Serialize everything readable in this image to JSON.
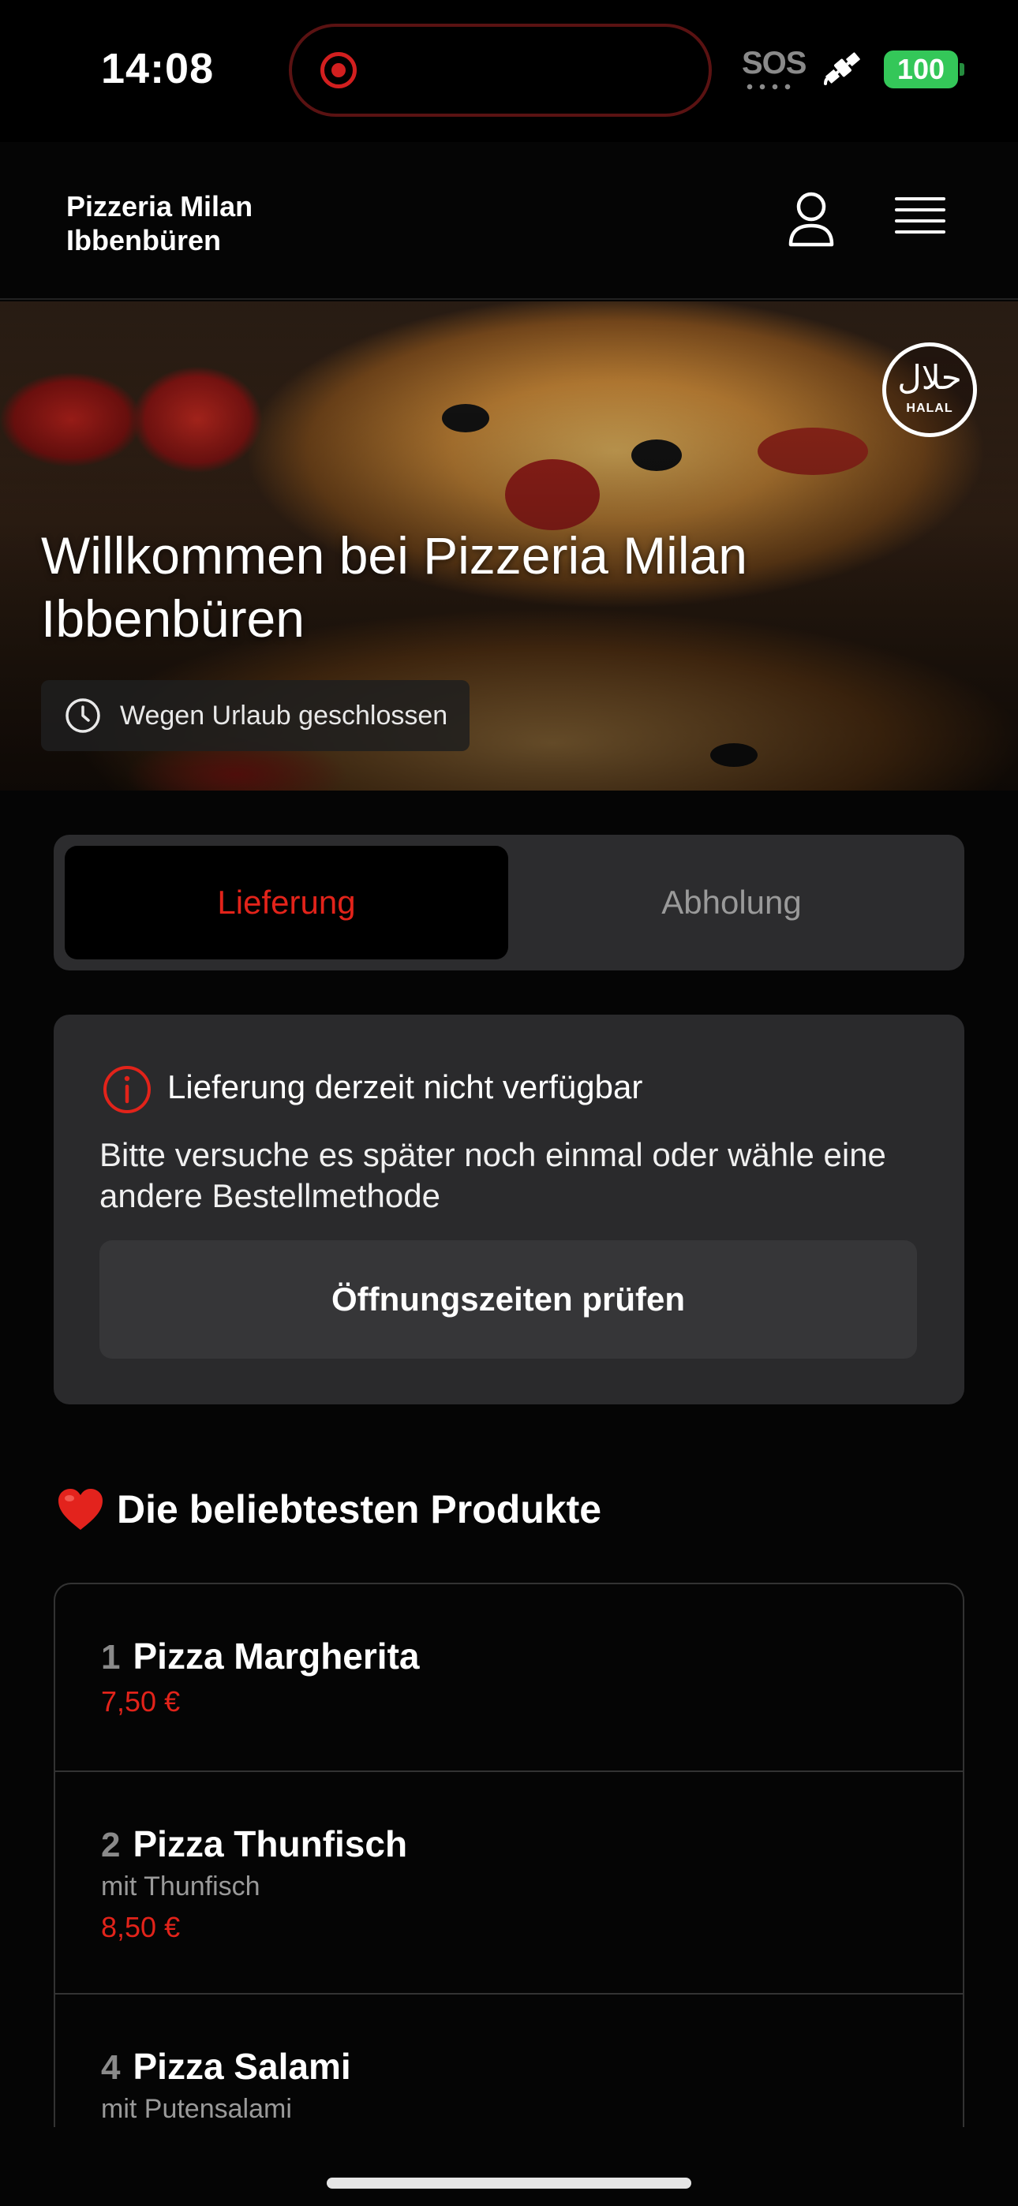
{
  "status_bar": {
    "time": "14:08",
    "sos": "SOS",
    "battery": "100"
  },
  "header": {
    "brand_line1": "Pizzeria Milan",
    "brand_line2": "Ibbenbüren"
  },
  "hero": {
    "title": "Willkommen bei Pizzeria Milan Ibbenbüren",
    "status_badge": "Wegen Urlaub geschlossen",
    "halal_arabic": "حلال",
    "halal_latin": "HALAL"
  },
  "order_mode": {
    "options": [
      "Lieferung",
      "Abholung"
    ],
    "selected": "Lieferung"
  },
  "notice": {
    "title": "Lieferung derzeit nicht verfügbar",
    "body": "Bitte versuche es später noch einmal oder wähle eine andere Bestellmethode",
    "button": "Öffnungszeiten prüfen"
  },
  "popular": {
    "title": "Die beliebtesten Produkte",
    "products": [
      {
        "rank": "1",
        "name": "Pizza Margherita",
        "description": "",
        "price": "7,50 €"
      },
      {
        "rank": "2",
        "name": "Pizza Thunfisch",
        "description": "mit Thunfisch",
        "price": "8,50 €"
      },
      {
        "rank": "4",
        "name": "Pizza Salami",
        "description": "mit Putensalami",
        "price": ""
      }
    ]
  },
  "colors": {
    "accent": "#e2231a",
    "background": "#050505",
    "card": "#2a2a2c",
    "battery": "#34c759"
  },
  "icons": [
    "record-icon",
    "satellite-icon",
    "user-icon",
    "menu-icon",
    "halal-icon",
    "clock-icon",
    "info-icon",
    "heart-icon"
  ]
}
